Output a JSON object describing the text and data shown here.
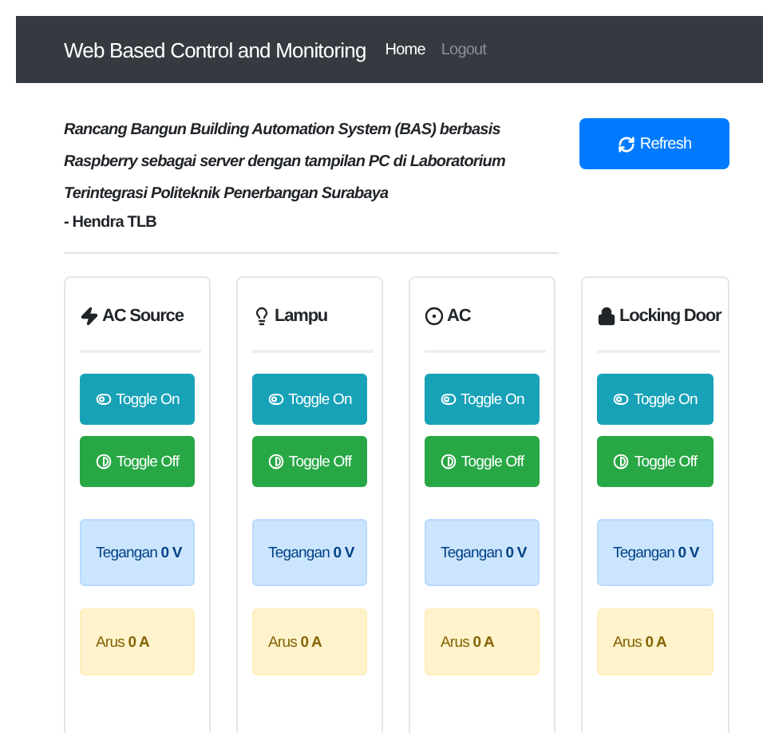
{
  "navbar": {
    "brand": "Web Based Control and Monitoring",
    "links": [
      {
        "label": "Home",
        "selected": true
      },
      {
        "label": "Logout",
        "selected": false
      }
    ]
  },
  "intro": {
    "title": "Rancang Bangun Building Automation System (BAS) berbasis Raspberry sebagai server dengan tampilan PC di Laboratorium Terintegrasi Politeknik Penerbangan Surabaya",
    "author": "- Hendra TLB"
  },
  "refresh_button": "Refresh",
  "devices": [
    {
      "kind": "bolt",
      "name": "AC Source",
      "toggle_on": "Toggle On",
      "toggle_off": "Toggle Off",
      "voltage": "Tegangan **0 V**",
      "current": "Arus **0 A**"
    },
    {
      "kind": "bulb",
      "name": "Lampu",
      "toggle_on": "Toggle On",
      "toggle_off": "Toggle Off",
      "voltage": "Tegangan **0 V**",
      "current": "Arus **0 A**"
    },
    {
      "kind": "dot",
      "name": "AC",
      "toggle_on": "Toggle On",
      "toggle_off": "Toggle Off",
      "voltage": "Tegangan **0 V**",
      "current": "Arus **0 A**"
    },
    {
      "kind": "lock",
      "name": "Locking Door",
      "toggle_on": "Toggle On",
      "toggle_off": "Toggle Off",
      "voltage": "Tegangan **0 V**",
      "current": "Arus **0 A**"
    }
  ]
}
